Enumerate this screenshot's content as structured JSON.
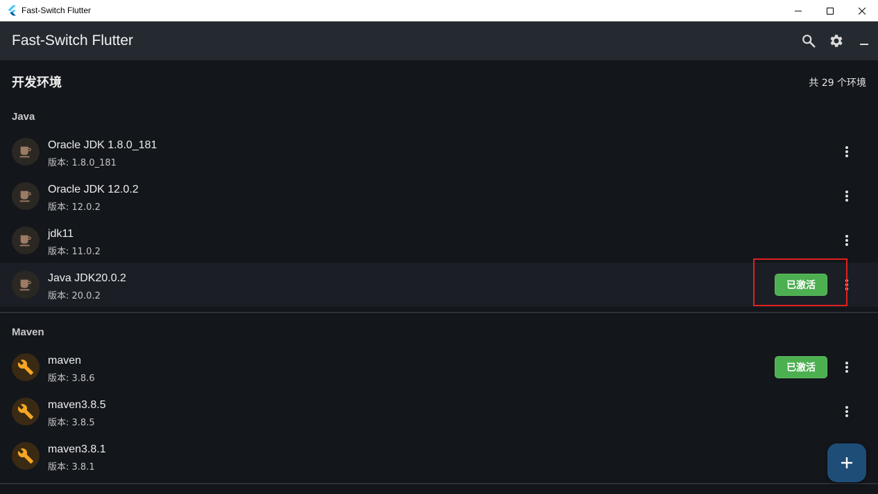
{
  "window": {
    "title": "Fast-Switch Flutter"
  },
  "appbar": {
    "title": "Fast-Switch Flutter"
  },
  "page": {
    "title": "开发环境",
    "count_text": "共 29 个环境"
  },
  "groups": [
    {
      "label": "Java",
      "items": [
        {
          "name": "Oracle JDK 1.8.0_181",
          "version": "版本: 1.8.0_181"
        },
        {
          "name": "Oracle JDK 12.0.2",
          "version": "版本: 12.0.2"
        },
        {
          "name": "jdk11",
          "version": "版本: 11.0.2"
        },
        {
          "name": "Java JDK20.0.2",
          "version": "版本: 20.0.2",
          "badge": "已激活"
        }
      ]
    },
    {
      "label": "Maven",
      "items": [
        {
          "name": "maven",
          "version": "版本: 3.8.6",
          "badge": "已激活"
        },
        {
          "name": "maven3.8.5",
          "version": "版本: 3.8.5"
        },
        {
          "name": "maven3.8.1",
          "version": "版本: 3.8.1"
        }
      ]
    }
  ],
  "icons": {
    "java": "coffee-cup-icon",
    "maven": "wrench-icon"
  },
  "colors": {
    "active_badge": "#4caf50",
    "fab": "#1e4d78",
    "highlight": "#e02020",
    "maven_icon": "#f5a623"
  }
}
